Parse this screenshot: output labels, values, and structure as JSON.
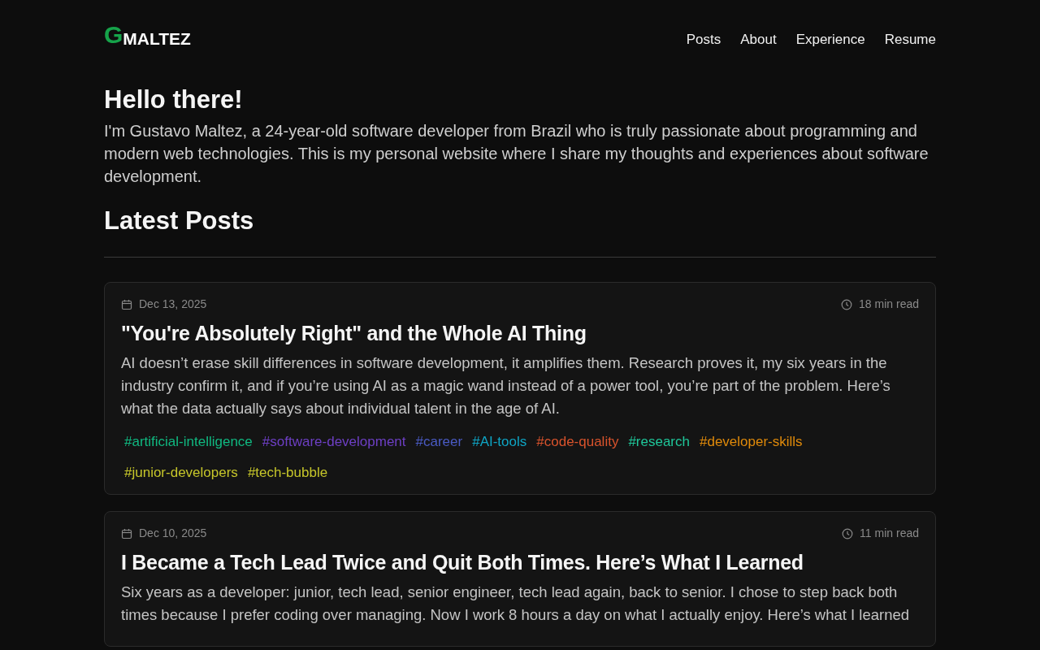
{
  "logo": {
    "mark": "G",
    "text": "MALTEZ"
  },
  "nav": [
    {
      "label": "Posts"
    },
    {
      "label": "About"
    },
    {
      "label": "Experience"
    },
    {
      "label": "Resume"
    }
  ],
  "intro": {
    "title": "Hello there!",
    "text": "I'm Gustavo Maltez, a 24-year-old software developer from Brazil who is truly passionate about programming and modern web technologies. This is my personal website where I share my thoughts and experiences about software development."
  },
  "section_title": "Latest Posts",
  "posts": [
    {
      "date": "Dec 13, 2025",
      "read_time": "18 min read",
      "title": "\"You're Absolutely Right\" and the Whole AI Thing",
      "excerpt": "AI doesn’t erase skill differences in software development, it amplifies them. Research proves it, my six years in the industry confirm it, and if you’re using AI as a magic wand instead of a power tool, you’re part of the problem. Here’s what the data actually says about individual talent in the age of AI.",
      "tags": [
        {
          "label": "#artificial-intelligence",
          "color": "#10b981"
        },
        {
          "label": "#software-development",
          "color": "#6d3fc4"
        },
        {
          "label": "#career",
          "color": "#4a5bc4"
        },
        {
          "label": "#AI-tools",
          "color": "#0ea5c5"
        },
        {
          "label": "#code-quality",
          "color": "#d9532c"
        },
        {
          "label": "#research",
          "color": "#1fc79a"
        },
        {
          "label": "#developer-skills",
          "color": "#e08a0a"
        },
        {
          "label": "#junior-developers",
          "color": "#c6c62a"
        },
        {
          "label": "#tech-bubble",
          "color": "#c6c62a"
        }
      ]
    },
    {
      "date": "Dec 10, 2025",
      "read_time": "11 min read",
      "title": "I Became a Tech Lead Twice and Quit Both Times. Here’s What I Learned",
      "excerpt": "Six years as a developer: junior, tech lead, senior engineer, tech lead again, back to senior. I chose to step back both times because I prefer coding over managing. Now I work 8 hours a day on what I actually enjoy. Here’s what I learned"
    }
  ]
}
